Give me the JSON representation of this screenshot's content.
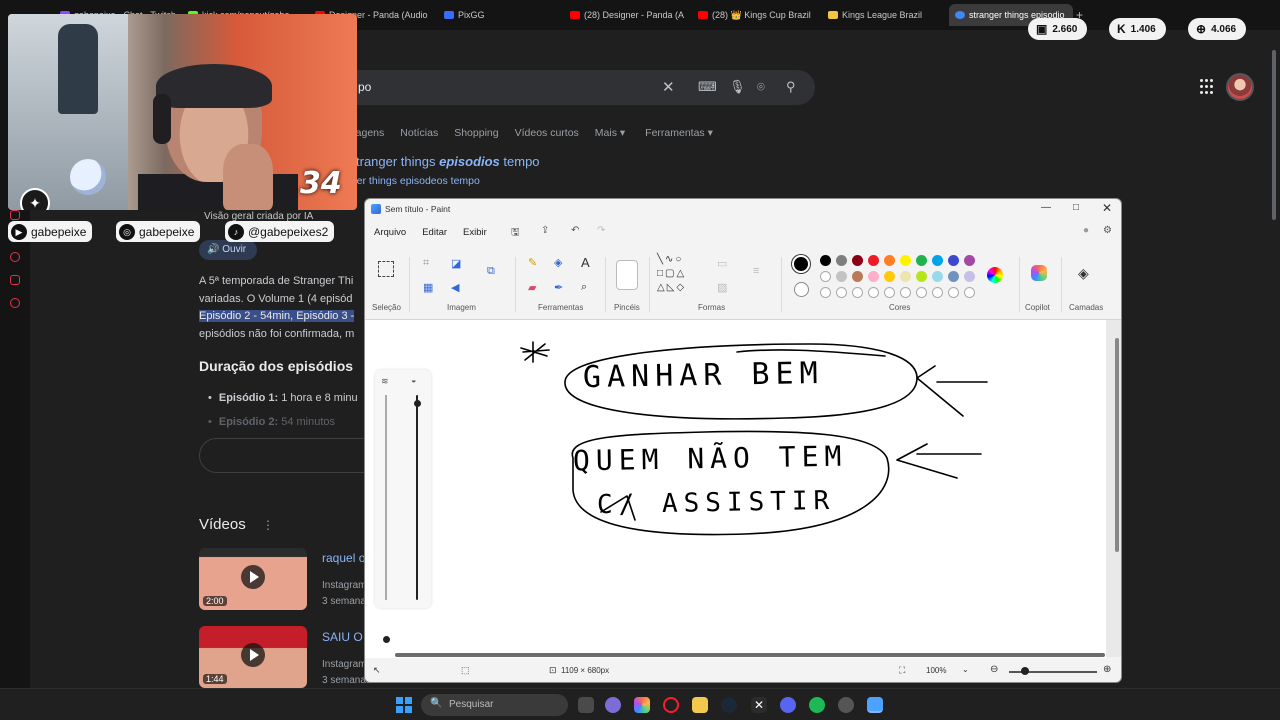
{
  "browser": {
    "tabs": [
      {
        "label": "gabepeixe - Chat - Twitch",
        "color": "#9146ff"
      },
      {
        "label": "kick.com/popout/gabe",
        "color": "#53fc18"
      },
      {
        "label": "Designer - Panda (Audio",
        "color": "#ff0000"
      },
      {
        "label": "PixGG",
        "color": "#3a6bff"
      },
      {
        "label": "(28) Designer - Panda (A",
        "color": "#ff0000"
      },
      {
        "label": "(28) 👑 Kings Cup Brazil",
        "color": "#ff0000"
      },
      {
        "label": "Kings League Brazil",
        "color": "#f4c542"
      },
      {
        "label": "stranger things episodio",
        "color": "#4285f4"
      }
    ],
    "new_tab": "+"
  },
  "stream_stats": [
    {
      "icon": "twitch-icon",
      "glyph": "▣",
      "value": "2.660"
    },
    {
      "icon": "kick-icon",
      "glyph": "K",
      "value": "1.406"
    },
    {
      "icon": "globe-icon",
      "glyph": "⊕",
      "value": "4.066"
    }
  ],
  "google": {
    "search_query": "po",
    "tabs": [
      "Imagens",
      "Notícias",
      "Shopping",
      "Vídeos curtos",
      "Mais ▾",
      "Ferramentas ▾"
    ],
    "did_you_mean_prefix": "tranger things ",
    "did_you_mean_bold": "episodios",
    "did_you_mean_suffix": " tempo",
    "searched_instead": "nger things episodeos tempo",
    "ai_overview_label": "Visão geral criada por IA",
    "listen_label": "🔊 Ouvir",
    "body_lines": [
      "A 5ª temporada de Stranger Thi",
      "variadas. O Volume 1 (4 episód",
      "Episódio 2 - 54min, Episódio 3 -",
      "episódios não foi confirmada, m"
    ],
    "section_heading": "Duração dos episódios",
    "episodes": [
      {
        "bold": "Episódio 1:",
        "text": " 1 hora e 8 minu"
      },
      {
        "bold": "Episódio 2:",
        "text": " 54 minutos"
      }
    ],
    "videos_heading": "Vídeos",
    "videos": [
      {
        "title": "raquel o",
        "source": "Instagram",
        "date": "3 semana",
        "duration": "2:00"
      },
      {
        "title": "SAIU O",
        "source": "Instagram",
        "date": "3 semanas atrás",
        "duration": "1:44"
      }
    ]
  },
  "webcam": {
    "jersey_number": "34",
    "socials": [
      {
        "icon": "youtube-icon",
        "glyph": "▶",
        "handle": "gabepeixe"
      },
      {
        "icon": "instagram-icon",
        "glyph": "◎",
        "handle": "gabepeixe"
      },
      {
        "icon": "tiktok-icon",
        "glyph": "♪",
        "handle": "@gabepeixes2"
      }
    ]
  },
  "paint": {
    "title": "Sem título - Paint",
    "menu": [
      "Arquivo",
      "Editar",
      "Exibir"
    ],
    "groups": [
      "Seleção",
      "Imagem",
      "Ferramentas",
      "Pincéis",
      "Formas",
      "Cores",
      "Copilot",
      "Camadas"
    ],
    "colors": [
      "#000000",
      "#7f7f7f",
      "#880015",
      "#ed1c24",
      "#ff7f27",
      "#fff200",
      "#22b14c",
      "#00a2e8",
      "#3f48cc",
      "#a349a4",
      "#ffffff",
      "#c3c3c3",
      "#b97a57",
      "#ffaec9",
      "#ffc90e",
      "#efe4b0",
      "#b5e61d",
      "#99d9ea",
      "#7092be",
      "#c8bfe7"
    ],
    "drawing_text": [
      "GANHAR BEM",
      "QUEM NÃO TEM",
      "C/ ASSISTIR"
    ],
    "canvas_size": "1109 × 680px",
    "zoom": "100%"
  },
  "taskbar": {
    "search_placeholder": "Pesquisar"
  }
}
